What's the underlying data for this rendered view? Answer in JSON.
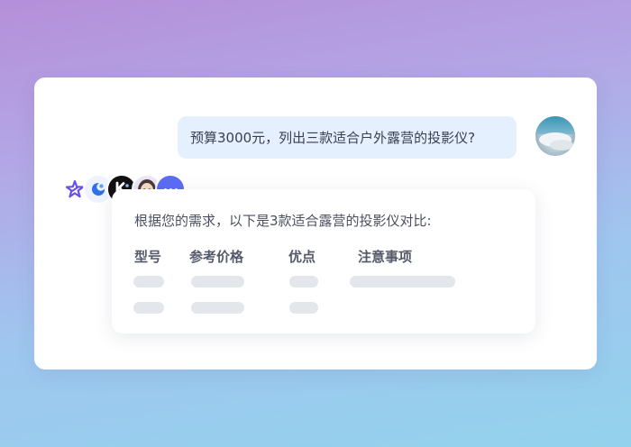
{
  "conversation": {
    "user_message": "预算3000元，列出三款适合户外露营的投影仪?",
    "answer_intro": "根据您的需求，以下是3款适合露营的投影仪对比:",
    "table_headers": [
      "型号",
      "参考价格",
      "优点",
      "注意事项"
    ]
  },
  "agents": [
    {
      "icon": "star-logo-icon"
    },
    {
      "icon": "swirl-logo-icon"
    },
    {
      "icon": "k-logo-icon",
      "label": "K"
    },
    {
      "icon": "girl-avatar-icon"
    },
    {
      "icon": "more-icon"
    }
  ],
  "colors": {
    "accent": "#5b6cf6",
    "user_bubble": "#e5f0ff",
    "skeleton": "#e3e7ec"
  }
}
